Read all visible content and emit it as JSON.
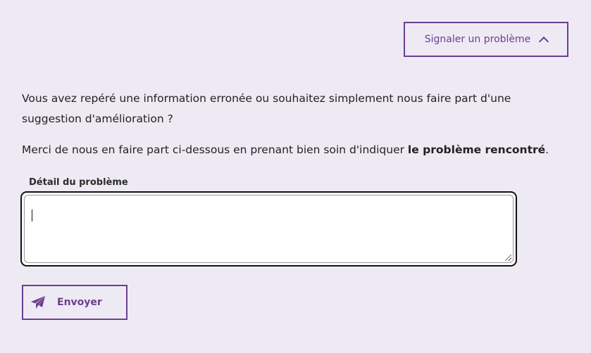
{
  "report_toggle": {
    "label": "Signaler un problème",
    "icon": "chevron-up-icon"
  },
  "intro_text": "Vous avez repéré une information erronée ou souhaitez simplement nous faire part d'une suggestion d'amélioration ?",
  "note": {
    "prefix": "Merci de nous en faire part ci-dessous en prenant bien soin d'indiquer ",
    "emphasis": "le problème rencontré",
    "suffix": "."
  },
  "problem_field": {
    "label": "Détail du problème",
    "value": ""
  },
  "send_button": {
    "label": "Envoyer",
    "icon": "paper-plane-icon"
  },
  "colors": {
    "accent": "#6b3f8f",
    "background": "#eeeaf4",
    "text": "#222222"
  }
}
